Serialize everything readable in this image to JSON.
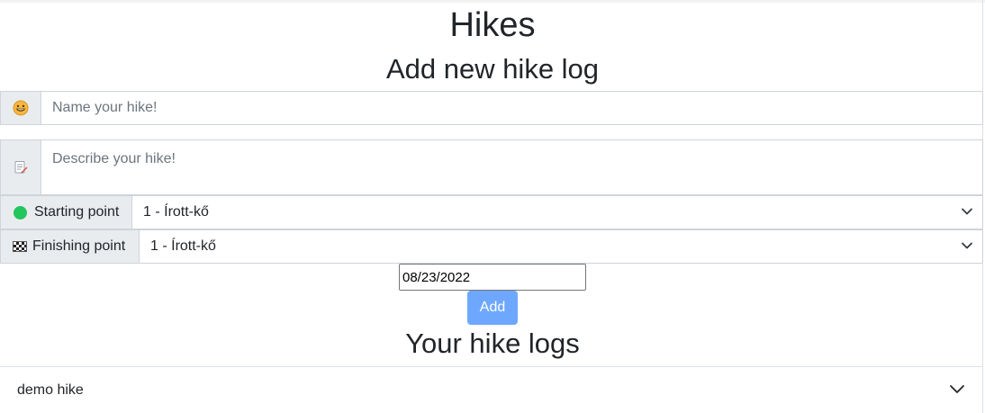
{
  "page": {
    "title": "Hikes",
    "add_section_title": "Add new hike log",
    "logs_section_title": "Your hike logs"
  },
  "form": {
    "name": {
      "icon": "grinning-face-icon",
      "placeholder": "Name your hike!"
    },
    "description": {
      "icon": "memo-pencil-icon",
      "placeholder": "Describe your hike!"
    },
    "starting_point": {
      "icon": "green-circle-icon",
      "label": "Starting point",
      "selected": "1 - Írott-kő"
    },
    "finishing_point": {
      "icon": "checkered-flag-icon",
      "label": "Finishing point",
      "selected": "1 - Írott-kő"
    },
    "date": "08/23/2022",
    "add_button": "Add"
  },
  "logs": [
    {
      "name": "demo hike"
    }
  ],
  "colors": {
    "accent_button": "#6ea8fe",
    "addon_bg": "#e9ecef",
    "start_dot": "#22c55e"
  }
}
